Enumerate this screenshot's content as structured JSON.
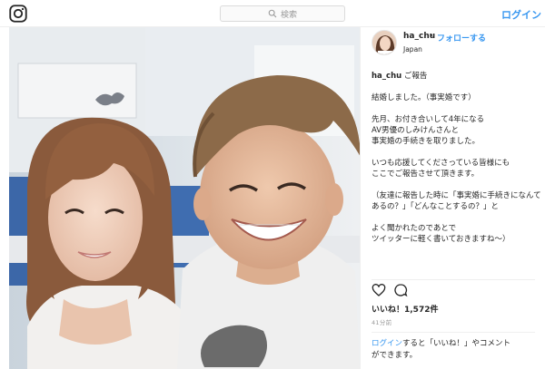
{
  "header": {
    "search_placeholder": "検索",
    "login_label": "ログイン"
  },
  "post": {
    "username": "ha_chu",
    "dot": "•",
    "follow_label": "フォローする",
    "location": "Japan",
    "caption_lines": [
      "ご報告",
      "",
      "結婚しました。（事実婚です）",
      "",
      "先月、お付き合いして4年になる",
      "AV男優のしみけんさんと",
      "事実婚の手続きを取りました。",
      "",
      "いつも応援してくださっている皆様にも",
      "ここでご報告させて頂きます。",
      "",
      "（友達に報告した時に「事実婚に手続きになんてあるの？」「どんなことするの？」と",
      "",
      "よく聞かれたのであとで",
      "ツイッターに軽く書いておきますね〜）"
    ],
    "likes_text": "いいね！1,572件",
    "time_text": "41分前",
    "comment_prompt": {
      "link": "ログイン",
      "rest_line1": "すると「いいね！」やコメント",
      "line2": "ができます。"
    }
  },
  "icons": [
    "instagram-logo-icon",
    "search-icon",
    "heart-icon",
    "comment-icon"
  ]
}
